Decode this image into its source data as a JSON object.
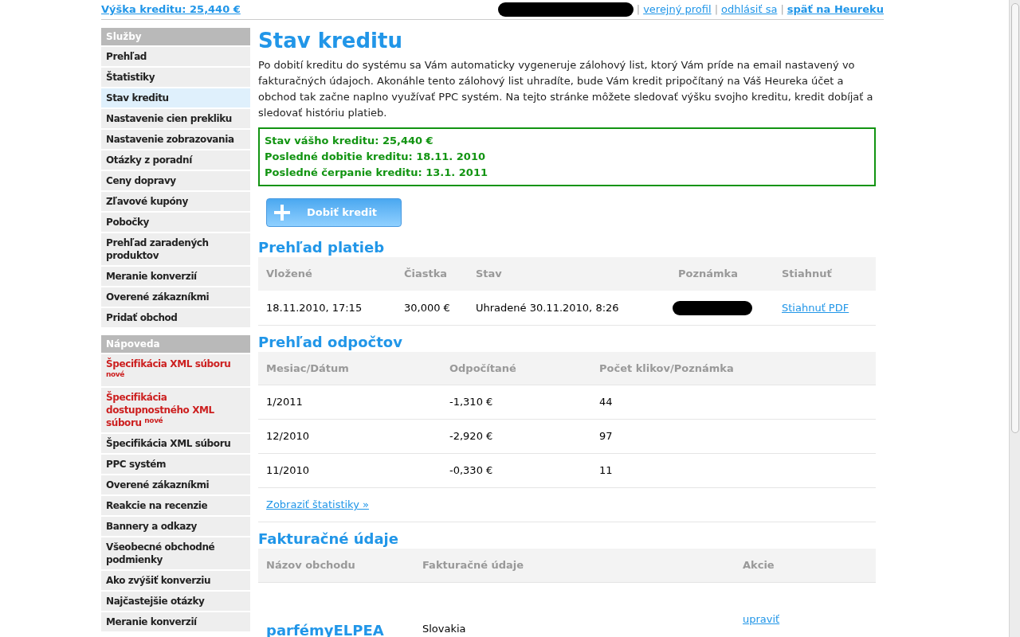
{
  "topbar": {
    "credit_link": "Výška kreditu: 25,440 €",
    "links": [
      {
        "label": "verejný profil",
        "bold": false
      },
      {
        "label": "odhlásiť sa",
        "bold": false
      },
      {
        "label": "späť na Heureku",
        "bold": true
      }
    ],
    "separator": "|"
  },
  "sidebar": [
    {
      "title": "Služby",
      "items": [
        {
          "label": "Prehľad",
          "selected": false,
          "highlight": false
        },
        {
          "label": "Štatistiky",
          "selected": false,
          "highlight": false
        },
        {
          "label": "Stav kreditu",
          "selected": true,
          "highlight": false
        },
        {
          "label": "Nastavenie cien prekliku",
          "selected": false,
          "highlight": false
        },
        {
          "label": "Nastavenie zobrazovania",
          "selected": false,
          "highlight": false
        },
        {
          "label": "Otázky z poradní",
          "selected": false,
          "highlight": false
        },
        {
          "label": "Ceny dopravy",
          "selected": false,
          "highlight": false
        },
        {
          "label": "Zľavové kupóny",
          "selected": false,
          "highlight": false
        },
        {
          "label": "Pobočky",
          "selected": false,
          "highlight": false
        },
        {
          "label": "Prehľad zaradených produktov",
          "selected": false,
          "highlight": false
        },
        {
          "label": "Meranie konverzií",
          "selected": false,
          "highlight": false
        },
        {
          "label": "Overené zákazníkmi",
          "selected": false,
          "highlight": false
        },
        {
          "label": "Pridať obchod",
          "selected": false,
          "highlight": false
        }
      ]
    },
    {
      "title": "Nápoveda",
      "items": [
        {
          "label": "Špecifikácia XML súboru $^{nové}$",
          "selected": false,
          "highlight": true
        },
        {
          "label": "Špecifikácia dostupnostného XML súboru $^{nové}$",
          "selected": false,
          "highlight": true
        },
        {
          "label": "Špecifikácia XML súboru",
          "selected": false,
          "highlight": false
        },
        {
          "label": "PPC systém",
          "selected": false,
          "highlight": false
        },
        {
          "label": "Overené zákazníkmi",
          "selected": false,
          "highlight": false
        },
        {
          "label": "Reakcie na recenzie",
          "selected": false,
          "highlight": false
        },
        {
          "label": "Bannery a odkazy",
          "selected": false,
          "highlight": false
        },
        {
          "label": "Všeobecné obchodné podmienky",
          "selected": false,
          "highlight": false
        },
        {
          "label": "Ako zvýšiť konverziu",
          "selected": false,
          "highlight": false
        },
        {
          "label": "Najčastejšie otázky",
          "selected": false,
          "highlight": false
        },
        {
          "label": "Meranie konverzií",
          "selected": false,
          "highlight": false
        }
      ]
    }
  ],
  "page_title": "Stav kreditu",
  "intro": "Po dobití kreditu do systému sa Vám automaticky vygeneruje zálohový list, ktorý Vám príde na email nastavený vo fakturačných údajoch. Akonáhle tento zálohový list uhradíte, bude Vám kredit pripočítaný na Váš Heureka účet a obchod tak začne naplno využívať PPC systém. Na tejto stránke môžete sledovať výšku svojho kreditu, kredit dobíjať a sledovať históriu platieb.",
  "summary": [
    "Stav vášho kreditu: 25,440 €",
    "Posledné dobitie kreditu: 18.11. 2010",
    "Posledné čerpanie kreditu: 13.1. 2011"
  ],
  "topup_button": "Dobiť kredit",
  "payments": {
    "title": "Prehľad platieb",
    "columns": [
      "Vložené",
      "Čiastka",
      "Stav",
      "Poznámka",
      "Stiahnuť"
    ],
    "rows": [
      {
        "date": "18.11.2010, 17:15",
        "amount": "30,000 €",
        "status": "Uhradené 30.11.2010, 8:26",
        "download": "Stiahnuť PDF"
      }
    ]
  },
  "deductions": {
    "title": "Prehľad odpočtov",
    "columns": [
      "Mesiac/Dátum",
      "Odpočítané",
      "Počet klikov/Poznámka"
    ],
    "rows": [
      [
        "1/2011",
        "-1,310 €",
        "44"
      ],
      [
        "12/2010",
        "-2,920 €",
        "97"
      ],
      [
        "11/2010",
        "-0,330 €",
        "11"
      ]
    ],
    "stats_link": "Zobraziť štatistiky »"
  },
  "billing": {
    "title": "Fakturačné údaje",
    "columns": [
      "Názov obchodu",
      "Fakturačné údaje",
      "Akcie"
    ],
    "rows": [
      {
        "shop": "parfémyELPEA",
        "details": "Slovakia",
        "action": "upraviť"
      }
    ]
  }
}
